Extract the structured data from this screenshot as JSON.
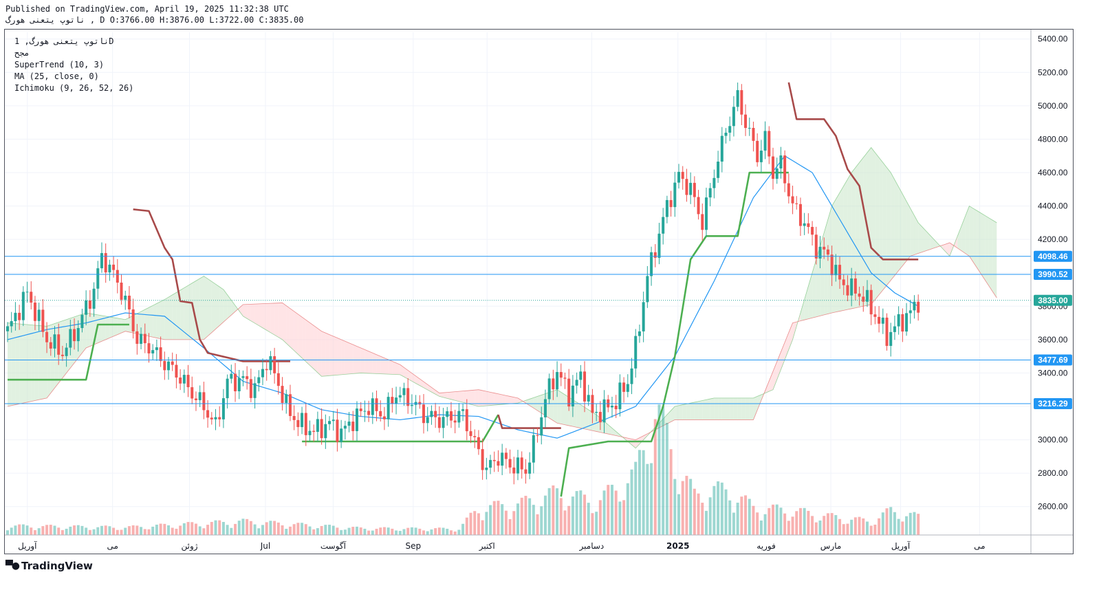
{
  "header": {
    "published_line": "Published on TradingView.com, April 19, 2025 11:32:38 UTC",
    "ohlc_line": "ناتوپ يتعنی هورگ , D O:3766.00 H:3876.00 L:3722.00 C:3835.00"
  },
  "legend": {
    "symbol": "ناتوپ يتعنی هورگ, 1D",
    "sub": "مجح",
    "supertrend": "SuperTrend (10, 3)",
    "ma": "MA (25, close, 0)",
    "ichimoku": "Ichimoku (9, 26, 52, 26)"
  },
  "footer": {
    "logo": "TradingView"
  },
  "colors": {
    "bull": "#26a69a",
    "bear": "#ef5350",
    "supertrend_up": "#4caf50",
    "supertrend_down": "#a84a4a",
    "ma": "#2196f3",
    "hline": "#2196f3",
    "cloud_green": "#c8e6c9",
    "cloud_red": "#ffcdd2"
  },
  "chart_data": {
    "type": "candlestick",
    "y_axis": {
      "ticks": [
        2600,
        2800,
        3000,
        3200,
        3400,
        3600,
        3800,
        4000,
        4200,
        4400,
        4600,
        4800,
        5000,
        5200,
        5400
      ],
      "tick_labels": [
        "2600.00",
        "2800.00",
        "3000.00",
        "3200.00",
        "3400.00",
        "3600.00",
        "3800.00",
        "4000.00",
        "4200.00",
        "4400.00",
        "4600.00",
        "4800.00",
        "5000.00",
        "5200.00",
        "5400.00"
      ],
      "range": [
        2430,
        5440
      ]
    },
    "x_axis": {
      "labels": [
        "آوریل",
        "می",
        "ژوئن",
        "Jul",
        "آگوست",
        "Sep",
        "اکتبر",
        "دسامبر",
        "2025",
        "فوریه",
        "مارس",
        "آوریل",
        "می"
      ],
      "label_positions": [
        0.022,
        0.105,
        0.18,
        0.254,
        0.32,
        0.398,
        0.47,
        0.572,
        0.656,
        0.742,
        0.805,
        0.873,
        0.95
      ]
    },
    "price_levels": [
      {
        "value": 4098.46,
        "label": "4098.46"
      },
      {
        "value": 3990.52,
        "label": "3990.52"
      },
      {
        "value": 3477.69,
        "label": "3477.69"
      },
      {
        "value": 3216.29,
        "label": "3216.29"
      }
    ],
    "last_price": {
      "value": 3835.0,
      "label": "3835.00"
    },
    "series_anchors": {
      "close": [
        [
          0,
          3650
        ],
        [
          5,
          3880
        ],
        [
          10,
          3600
        ],
        [
          14,
          3520
        ],
        [
          18,
          3680
        ],
        [
          22,
          3900
        ],
        [
          24,
          4100
        ],
        [
          28,
          3950
        ],
        [
          31,
          3760
        ],
        [
          33,
          3600
        ],
        [
          36,
          3560
        ],
        [
          40,
          3460
        ],
        [
          43,
          3400
        ],
        [
          47,
          3280
        ],
        [
          50,
          3200
        ],
        [
          53,
          3080
        ],
        [
          56,
          3350
        ],
        [
          60,
          3360
        ],
        [
          63,
          3300
        ],
        [
          66,
          3480
        ],
        [
          68,
          3400
        ],
        [
          71,
          3200
        ],
        [
          74,
          3100
        ],
        [
          78,
          3050
        ],
        [
          82,
          3100
        ],
        [
          85,
          3040
        ],
        [
          88,
          3120
        ],
        [
          92,
          3200
        ],
        [
          96,
          3150
        ],
        [
          99,
          3280
        ],
        [
          103,
          3230
        ],
        [
          106,
          3150
        ],
        [
          110,
          3120
        ],
        [
          114,
          3140
        ],
        [
          116,
          3150
        ],
        [
          119,
          2980
        ],
        [
          122,
          2820
        ],
        [
          125,
          2900
        ],
        [
          128,
          2850
        ],
        [
          132,
          2820
        ],
        [
          134,
          2960
        ],
        [
          137,
          3250
        ],
        [
          140,
          3410
        ],
        [
          143,
          3270
        ],
        [
          146,
          3380
        ],
        [
          149,
          3150
        ],
        [
          152,
          3180
        ],
        [
          155,
          3230
        ],
        [
          158,
          3350
        ],
        [
          160,
          3550
        ],
        [
          163,
          3980
        ],
        [
          165,
          4150
        ],
        [
          168,
          4400
        ],
        [
          171,
          4580
        ],
        [
          174,
          4500
        ],
        [
          177,
          4300
        ],
        [
          180,
          4600
        ],
        [
          183,
          4850
        ],
        [
          186,
          5050
        ],
        [
          188,
          4900
        ],
        [
          191,
          4700
        ],
        [
          193,
          4800
        ],
        [
          195,
          4600
        ],
        [
          197,
          4650
        ],
        [
          200,
          4400
        ],
        [
          203,
          4300
        ],
        [
          206,
          4150
        ],
        [
          209,
          4100
        ],
        [
          212,
          3950
        ],
        [
          215,
          3900
        ],
        [
          218,
          3860
        ],
        [
          221,
          3750
        ],
        [
          224,
          3620
        ],
        [
          227,
          3700
        ],
        [
          230,
          3760
        ],
        [
          232,
          3835
        ]
      ],
      "volume": [
        [
          0,
          30
        ],
        [
          30,
          25
        ],
        [
          60,
          45
        ],
        [
          90,
          22
        ],
        [
          115,
          20
        ],
        [
          120,
          90
        ],
        [
          130,
          100
        ],
        [
          140,
          140
        ],
        [
          150,
          110
        ],
        [
          160,
          200
        ],
        [
          165,
          420
        ],
        [
          170,
          250
        ],
        [
          175,
          130
        ],
        [
          180,
          150
        ],
        [
          185,
          140
        ],
        [
          190,
          90
        ],
        [
          200,
          80
        ],
        [
          210,
          60
        ],
        [
          220,
          45
        ],
        [
          225,
          80
        ],
        [
          232,
          60
        ]
      ],
      "volume_max": 500,
      "supertrend_up": [
        [
          0,
          3360
        ],
        [
          20,
          3360
        ],
        [
          23,
          3690
        ],
        [
          31,
          3690
        ]
      ],
      "supertrend_down": [
        [
          32,
          4380
        ],
        [
          36,
          4370
        ],
        [
          40,
          4150
        ],
        [
          42,
          4080
        ],
        [
          44,
          3830
        ],
        [
          47,
          3820
        ],
        [
          49,
          3600
        ],
        [
          51,
          3520
        ],
        [
          60,
          3470
        ],
        [
          72,
          3470
        ]
      ],
      "supertrend_up2": [
        [
          75,
          2990
        ],
        [
          121,
          2990
        ],
        [
          125,
          3150
        ]
      ],
      "supertrend_down2": [
        [
          125,
          3150
        ],
        [
          126,
          3070
        ],
        [
          141,
          3070
        ]
      ],
      "supertrend_up3": [
        [
          141,
          2660
        ],
        [
          143,
          2950
        ],
        [
          153,
          2990
        ],
        [
          164,
          2990
        ],
        [
          167,
          3200
        ],
        [
          170,
          3500
        ],
        [
          174,
          4080
        ],
        [
          178,
          4220
        ],
        [
          186,
          4220
        ],
        [
          189,
          4600
        ],
        [
          199,
          4600
        ]
      ],
      "supertrend_down3": [
        [
          199,
          5140
        ],
        [
          201,
          4920
        ],
        [
          208,
          4920
        ],
        [
          211,
          4820
        ],
        [
          214,
          4620
        ],
        [
          217,
          4520
        ],
        [
          220,
          4150
        ],
        [
          223,
          4080
        ],
        [
          232,
          4080
        ]
      ],
      "ma": [
        [
          0,
          3600
        ],
        [
          10,
          3660
        ],
        [
          20,
          3700
        ],
        [
          30,
          3760
        ],
        [
          40,
          3740
        ],
        [
          50,
          3550
        ],
        [
          60,
          3350
        ],
        [
          70,
          3280
        ],
        [
          80,
          3180
        ],
        [
          90,
          3140
        ],
        [
          100,
          3120
        ],
        [
          110,
          3150
        ],
        [
          120,
          3140
        ],
        [
          130,
          3060
        ],
        [
          140,
          3010
        ],
        [
          150,
          3100
        ],
        [
          160,
          3200
        ],
        [
          170,
          3500
        ],
        [
          180,
          3950
        ],
        [
          190,
          4450
        ],
        [
          198,
          4700
        ],
        [
          205,
          4600
        ],
        [
          210,
          4400
        ],
        [
          215,
          4200
        ],
        [
          220,
          4000
        ],
        [
          226,
          3880
        ],
        [
          232,
          3800
        ]
      ],
      "cloud_a": [
        [
          0,
          3700
        ],
        [
          10,
          3680
        ],
        [
          20,
          3760
        ],
        [
          30,
          3720
        ],
        [
          40,
          3840
        ],
        [
          50,
          3980
        ],
        [
          55,
          3900
        ],
        [
          60,
          3740
        ],
        [
          70,
          3600
        ],
        [
          80,
          3380
        ],
        [
          90,
          3400
        ],
        [
          100,
          3390
        ],
        [
          110,
          3260
        ],
        [
          120,
          3200
        ],
        [
          130,
          3220
        ],
        [
          140,
          3300
        ],
        [
          150,
          3150
        ],
        [
          160,
          2950
        ],
        [
          170,
          3200
        ],
        [
          180,
          3250
        ],
        [
          190,
          3250
        ],
        [
          195,
          3300
        ],
        [
          200,
          3600
        ],
        [
          205,
          4000
        ],
        [
          210,
          4400
        ],
        [
          215,
          4600
        ],
        [
          220,
          4750
        ],
        [
          225,
          4600
        ],
        [
          232,
          4300
        ],
        [
          240,
          4100
        ],
        [
          245,
          4400
        ],
        [
          252,
          4300
        ]
      ],
      "cloud_b": [
        [
          0,
          3200
        ],
        [
          10,
          3250
        ],
        [
          20,
          3550
        ],
        [
          30,
          3650
        ],
        [
          40,
          3600
        ],
        [
          50,
          3600
        ],
        [
          60,
          3810
        ],
        [
          70,
          3820
        ],
        [
          80,
          3650
        ],
        [
          90,
          3550
        ],
        [
          100,
          3450
        ],
        [
          110,
          3280
        ],
        [
          120,
          3300
        ],
        [
          130,
          3250
        ],
        [
          140,
          3100
        ],
        [
          150,
          3050
        ],
        [
          160,
          3000
        ],
        [
          170,
          3120
        ],
        [
          180,
          3120
        ],
        [
          190,
          3120
        ],
        [
          200,
          3700
        ],
        [
          210,
          3760
        ],
        [
          220,
          3810
        ],
        [
          230,
          4100
        ],
        [
          240,
          4180
        ],
        [
          245,
          4100
        ],
        [
          252,
          3850
        ]
      ]
    }
  }
}
